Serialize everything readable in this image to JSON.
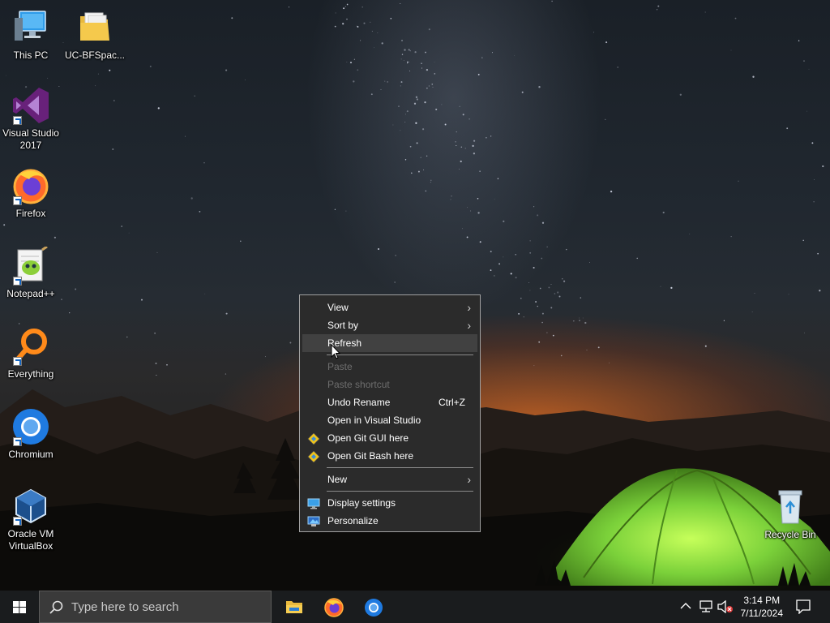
{
  "desktop": {
    "icons": [
      {
        "label": "This PC",
        "icon": "this-pc-icon"
      },
      {
        "label": "UC-BFSpac...",
        "icon": "folder-icon"
      },
      {
        "label": "Visual Studio 2017",
        "icon": "visual-studio-icon"
      },
      {
        "label": "Firefox",
        "icon": "firefox-icon"
      },
      {
        "label": "Notepad++",
        "icon": "notepad-plus-plus-icon"
      },
      {
        "label": "Everything",
        "icon": "everything-search-icon"
      },
      {
        "label": "Chromium",
        "icon": "chromium-icon"
      },
      {
        "label": "Oracle VM VirtualBox",
        "icon": "virtualbox-icon"
      },
      {
        "label": "Recycle Bin",
        "icon": "recycle-bin-icon"
      }
    ]
  },
  "context_menu": {
    "items": [
      {
        "label": "View",
        "submenu": true
      },
      {
        "label": "Sort by",
        "submenu": true
      },
      {
        "label": "Refresh",
        "highlighted": true
      },
      {
        "label": "Paste",
        "disabled": true
      },
      {
        "label": "Paste shortcut",
        "disabled": true
      },
      {
        "label": "Undo Rename",
        "shortcut": "Ctrl+Z"
      },
      {
        "label": "Open in Visual Studio"
      },
      {
        "label": "Open Git GUI here",
        "icon": "git-gui-icon"
      },
      {
        "label": "Open Git Bash here",
        "icon": "git-bash-icon"
      },
      {
        "label": "New",
        "submenu": true
      },
      {
        "label": "Display settings",
        "icon": "display-settings-icon"
      },
      {
        "label": "Personalize",
        "icon": "personalize-icon"
      }
    ]
  },
  "taskbar": {
    "search_placeholder": "Type here to search",
    "pinned_apps": [
      "file-explorer-icon",
      "firefox-icon",
      "chromium-icon"
    ],
    "clock": {
      "time": "3:14 PM",
      "date": "7/11/2024"
    }
  },
  "colors": {
    "menu_background": "#2b2b2b",
    "menu_highlight": "#414141",
    "taskbar": "#1a1c1e",
    "tent_green": "#7bd13a"
  }
}
